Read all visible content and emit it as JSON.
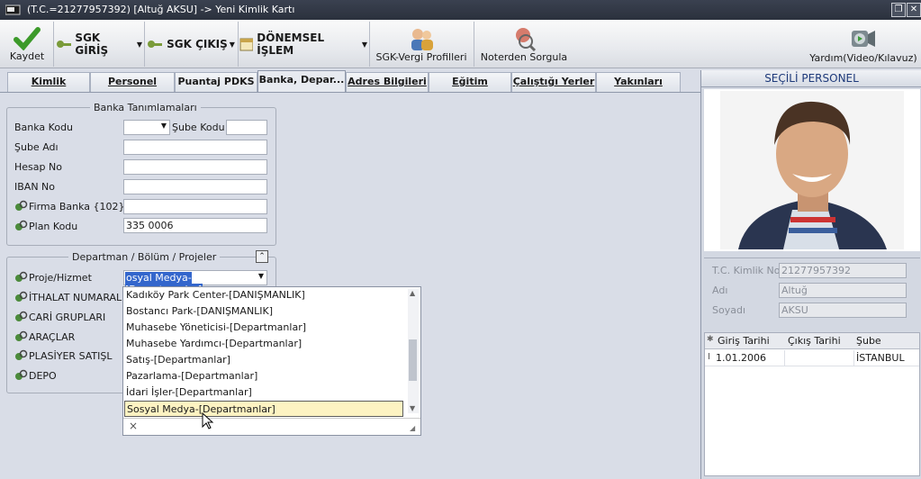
{
  "window": {
    "title": "(T.C.=21277957392) [Altuğ AKSU] -> Yeni Kimlik Kartı"
  },
  "toolbar": {
    "save": "Kaydet",
    "sgk_giris": "SGK GİRİŞ",
    "sgk_cikis": "SGK ÇIKIŞ",
    "donemsel": "DÖNEMSEL İŞLEM",
    "sgk_vergi": "SGK-Vergi Profilleri",
    "noter": "Noterden Sorgula",
    "help": "Yardım(Video/Kılavuz)"
  },
  "tabs": [
    "Kimlik Bilgileri",
    "Personel Bilg...",
    "Puantaj PDKS",
    "Banka, Depar...",
    "Adres Bilgileri",
    "Eğitim Bilgileri",
    "Çalıştığı Yerler",
    "Yakınları"
  ],
  "bank": {
    "legend": "Banka Tanımlamaları",
    "banka_kodu": "Banka Kodu",
    "sube_kodu": "Şube Kodu",
    "sube_adi": "Şube Adı",
    "hesap_no": "Hesap No",
    "iban": "IBAN No",
    "firma_banka": "Firma Banka {102}",
    "plan_kodu": "Plan Kodu",
    "plan_kodu_value": "335 0006"
  },
  "dept": {
    "legend": "Departman / Bölüm / Projeler",
    "proje": "Proje/Hizmet",
    "proje_value": "osyal Medya-[Departmanlar]",
    "ithalat": "İTHALAT NUMARAL",
    "cari": "CARİ GRUPLARI",
    "araclar": "ARAÇLAR",
    "plasiyer": "PLASİYER SATIŞL",
    "depo": "DEPO"
  },
  "dropdown_items": [
    "Kadıköy Park Center-[DANIŞMANLIK]",
    "Bostancı Park-[DANIŞMANLIK]",
    "Muhasebe Yöneticisi-[Departmanlar]",
    "Muhasebe Yardımcı-[Departmanlar]",
    "Satış-[Departmanlar]",
    "Pazarlama-[Departmanlar]",
    "İdari İşler-[Departmanlar]",
    "Sosyal Medya-[Departmanlar]"
  ],
  "dropdown_close": "×",
  "right": {
    "header": "SEÇİLİ PERSONEL",
    "tc_label": "T.C. Kimlik No",
    "tc_value": "21277957392",
    "adi_label": "Adı",
    "adi_value": "Altuğ",
    "soyadi_label": "Soyadı",
    "soyadi_value": "AKSU",
    "grid_headers": [
      "Giriş Tarihi",
      "Çıkış Tarihi",
      "Şube"
    ],
    "grid_row": {
      "giris": "1.01.2006",
      "cikis": "",
      "sube": "İSTANBUL"
    }
  }
}
